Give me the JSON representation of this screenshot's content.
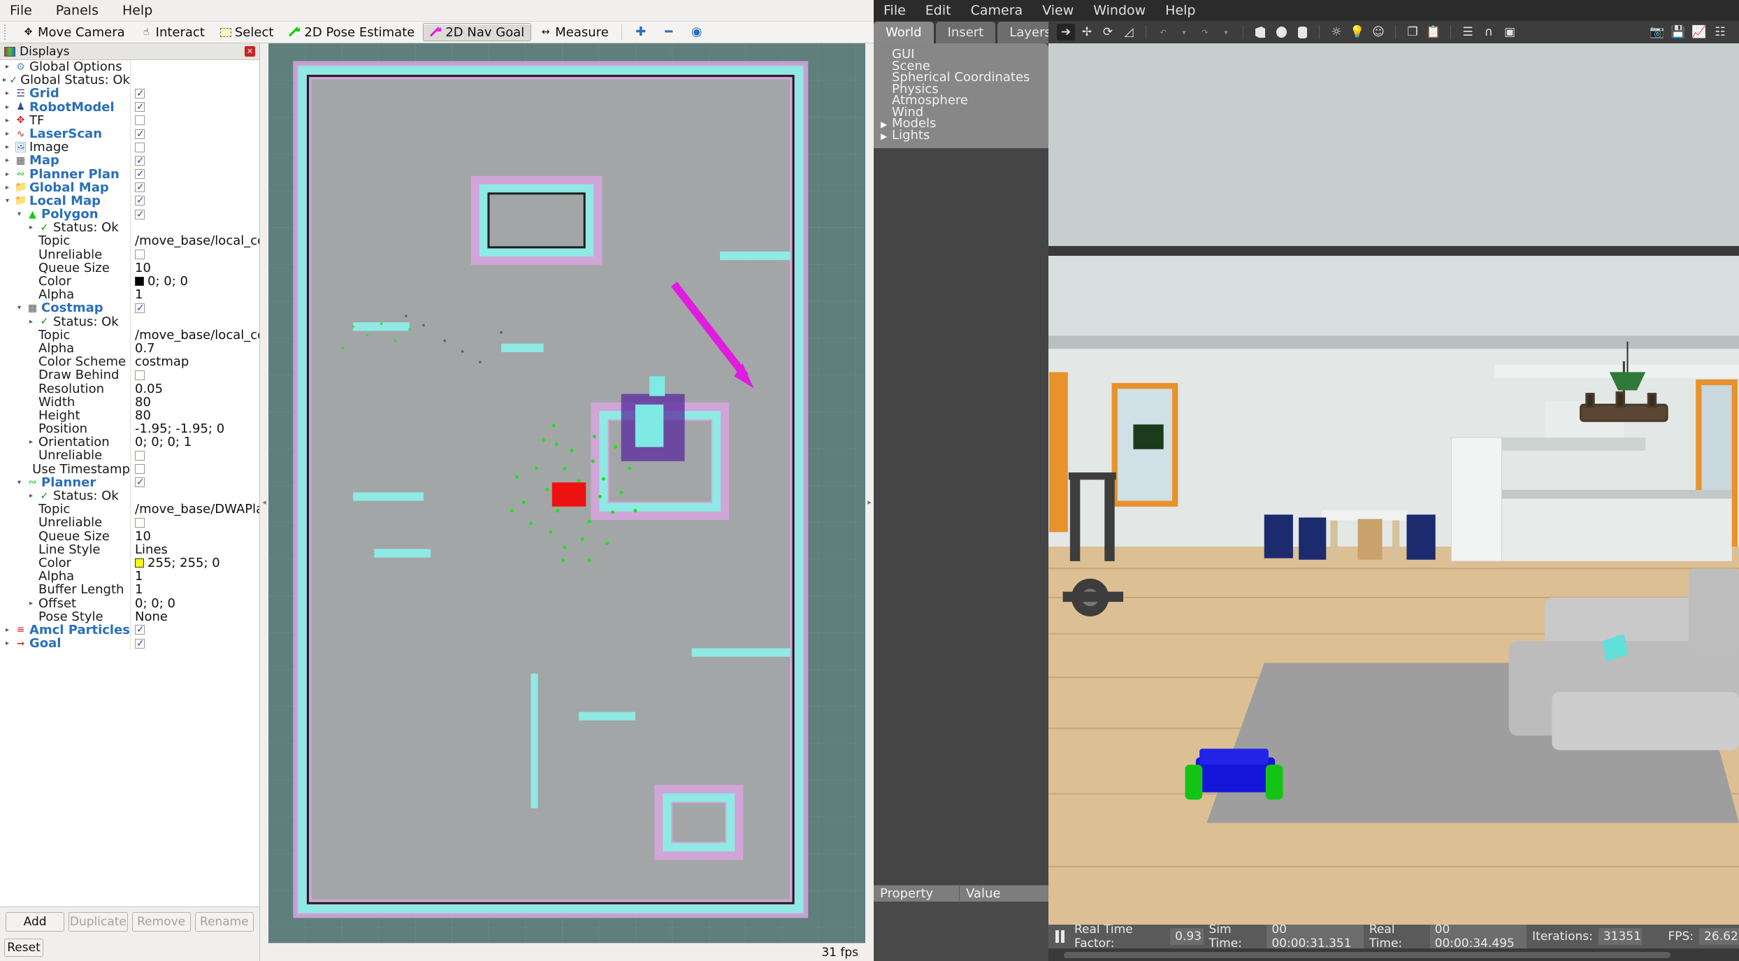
{
  "rviz": {
    "menubar": [
      "File",
      "Panels",
      "Help"
    ],
    "toolbar": [
      {
        "label": "Move Camera",
        "icon": "move-camera-icon",
        "active": false
      },
      {
        "label": "Interact",
        "icon": "hand-icon",
        "active": false
      },
      {
        "label": "Select",
        "icon": "select-rect-icon",
        "active": false
      },
      {
        "label": "2D Pose Estimate",
        "icon": "green-arrow-icon",
        "active": false
      },
      {
        "label": "2D Nav Goal",
        "icon": "magenta-arrow-icon",
        "active": true
      },
      {
        "label": "Measure",
        "icon": "measure-icon",
        "active": false
      }
    ],
    "displays_title": "Displays",
    "tree": [
      {
        "indent": 0,
        "arrow": "r",
        "icon": "gear",
        "label": "Global Options",
        "link": false,
        "value": "",
        "type": "none"
      },
      {
        "indent": 0,
        "arrow": "r",
        "icon": "check",
        "label": "Global Status: Ok",
        "link": false,
        "value": "",
        "type": "none"
      },
      {
        "indent": 0,
        "arrow": "r",
        "icon": "grid",
        "label": "Grid",
        "link": true,
        "value": "",
        "type": "check-on"
      },
      {
        "indent": 0,
        "arrow": "r",
        "icon": "robot",
        "label": "RobotModel",
        "link": true,
        "value": "",
        "type": "check-on"
      },
      {
        "indent": 0,
        "arrow": "r",
        "icon": "tf",
        "label": "TF",
        "link": false,
        "value": "",
        "type": "check-off"
      },
      {
        "indent": 0,
        "arrow": "r",
        "icon": "laser",
        "label": "LaserScan",
        "link": true,
        "value": "",
        "type": "check-on"
      },
      {
        "indent": 0,
        "arrow": "r",
        "icon": "image",
        "label": "Image",
        "link": false,
        "value": "",
        "type": "check-off"
      },
      {
        "indent": 0,
        "arrow": "r",
        "icon": "map",
        "label": "Map",
        "link": true,
        "value": "",
        "type": "check-on"
      },
      {
        "indent": 0,
        "arrow": "r",
        "icon": "path",
        "label": "Planner Plan",
        "link": true,
        "value": "",
        "type": "check-on"
      },
      {
        "indent": 0,
        "arrow": "r",
        "icon": "folder",
        "label": "Global Map",
        "link": true,
        "value": "",
        "type": "check-on"
      },
      {
        "indent": 0,
        "arrow": "d",
        "icon": "folder",
        "label": "Local Map",
        "link": true,
        "value": "",
        "type": "check-on"
      },
      {
        "indent": 1,
        "arrow": "d",
        "icon": "polygon",
        "label": "Polygon",
        "link": true,
        "value": "",
        "type": "check-on"
      },
      {
        "indent": 2,
        "arrow": "r",
        "icon": "check",
        "label": "Status: Ok",
        "link": false,
        "value": "",
        "type": "none"
      },
      {
        "indent": 2,
        "arrow": "none",
        "icon": "none",
        "label": "Topic",
        "link": false,
        "value": "/move_base/local_cost...",
        "type": "text"
      },
      {
        "indent": 2,
        "arrow": "none",
        "icon": "none",
        "label": "Unreliable",
        "link": false,
        "value": "",
        "type": "check-off"
      },
      {
        "indent": 2,
        "arrow": "none",
        "icon": "none",
        "label": "Queue Size",
        "link": false,
        "value": "10",
        "type": "text"
      },
      {
        "indent": 2,
        "arrow": "none",
        "icon": "none",
        "label": "Color",
        "link": false,
        "value": "0; 0; 0",
        "type": "color",
        "swatch": "#000000"
      },
      {
        "indent": 2,
        "arrow": "none",
        "icon": "none",
        "label": "Alpha",
        "link": false,
        "value": "1",
        "type": "text"
      },
      {
        "indent": 1,
        "arrow": "d",
        "icon": "map",
        "label": "Costmap",
        "link": true,
        "value": "",
        "type": "check-on"
      },
      {
        "indent": 2,
        "arrow": "r",
        "icon": "check",
        "label": "Status: Ok",
        "link": false,
        "value": "",
        "type": "none"
      },
      {
        "indent": 2,
        "arrow": "none",
        "icon": "none",
        "label": "Topic",
        "link": false,
        "value": "/move_base/local_cost...",
        "type": "text"
      },
      {
        "indent": 2,
        "arrow": "none",
        "icon": "none",
        "label": "Alpha",
        "link": false,
        "value": "0.7",
        "type": "text"
      },
      {
        "indent": 2,
        "arrow": "none",
        "icon": "none",
        "label": "Color Scheme",
        "link": false,
        "value": "costmap",
        "type": "text"
      },
      {
        "indent": 2,
        "arrow": "none",
        "icon": "none",
        "label": "Draw Behind",
        "link": false,
        "value": "",
        "type": "check-off"
      },
      {
        "indent": 2,
        "arrow": "none",
        "icon": "none",
        "label": "Resolution",
        "link": false,
        "value": "0.05",
        "type": "text"
      },
      {
        "indent": 2,
        "arrow": "none",
        "icon": "none",
        "label": "Width",
        "link": false,
        "value": "80",
        "type": "text"
      },
      {
        "indent": 2,
        "arrow": "none",
        "icon": "none",
        "label": "Height",
        "link": false,
        "value": "80",
        "type": "text"
      },
      {
        "indent": 2,
        "arrow": "none",
        "icon": "none",
        "label": "Position",
        "link": false,
        "value": "-1.95; -1.95; 0",
        "type": "text"
      },
      {
        "indent": 2,
        "arrow": "r",
        "icon": "none",
        "label": "Orientation",
        "link": false,
        "value": "0; 0; 0; 1",
        "type": "text"
      },
      {
        "indent": 2,
        "arrow": "none",
        "icon": "none",
        "label": "Unreliable",
        "link": false,
        "value": "",
        "type": "check-off"
      },
      {
        "indent": 2,
        "arrow": "none",
        "icon": "none",
        "label": "Use Timestamp",
        "link": false,
        "value": "",
        "type": "check-off"
      },
      {
        "indent": 1,
        "arrow": "d",
        "icon": "path",
        "label": "Planner",
        "link": true,
        "value": "",
        "type": "check-on"
      },
      {
        "indent": 2,
        "arrow": "r",
        "icon": "check",
        "label": "Status: Ok",
        "link": false,
        "value": "",
        "type": "none"
      },
      {
        "indent": 2,
        "arrow": "none",
        "icon": "none",
        "label": "Topic",
        "link": false,
        "value": "/move_base/DWAPlan...",
        "type": "text"
      },
      {
        "indent": 2,
        "arrow": "none",
        "icon": "none",
        "label": "Unreliable",
        "link": false,
        "value": "",
        "type": "check-off"
      },
      {
        "indent": 2,
        "arrow": "none",
        "icon": "none",
        "label": "Queue Size",
        "link": false,
        "value": "10",
        "type": "text"
      },
      {
        "indent": 2,
        "arrow": "none",
        "icon": "none",
        "label": "Line Style",
        "link": false,
        "value": "Lines",
        "type": "text"
      },
      {
        "indent": 2,
        "arrow": "none",
        "icon": "none",
        "label": "Color",
        "link": false,
        "value": "255; 255; 0",
        "type": "color",
        "swatch": "#ffff00"
      },
      {
        "indent": 2,
        "arrow": "none",
        "icon": "none",
        "label": "Alpha",
        "link": false,
        "value": "1",
        "type": "text"
      },
      {
        "indent": 2,
        "arrow": "none",
        "icon": "none",
        "label": "Buffer Length",
        "link": false,
        "value": "1",
        "type": "text"
      },
      {
        "indent": 2,
        "arrow": "r",
        "icon": "none",
        "label": "Offset",
        "link": false,
        "value": "0; 0; 0",
        "type": "text"
      },
      {
        "indent": 2,
        "arrow": "none",
        "icon": "none",
        "label": "Pose Style",
        "link": false,
        "value": "None",
        "type": "text"
      },
      {
        "indent": 0,
        "arrow": "r",
        "icon": "particles",
        "label": "Amcl Particles",
        "link": true,
        "value": "",
        "type": "check-on"
      },
      {
        "indent": 0,
        "arrow": "r",
        "icon": "goal",
        "label": "Goal",
        "link": true,
        "value": "",
        "type": "check-on"
      }
    ],
    "buttons": {
      "add": "Add",
      "duplicate": "Duplicate",
      "remove": "Remove",
      "rename": "Rename",
      "reset": "Reset"
    },
    "status_fps": "31 fps"
  },
  "gazebo": {
    "menubar": [
      "File",
      "Edit",
      "Camera",
      "View",
      "Window",
      "Help"
    ],
    "tabs": [
      {
        "label": "World",
        "active": true
      },
      {
        "label": "Insert",
        "active": false
      },
      {
        "label": "Layers",
        "active": false
      }
    ],
    "world_tree": [
      {
        "label": "GUI",
        "expandable": false
      },
      {
        "label": "Scene",
        "expandable": false
      },
      {
        "label": "Spherical Coordinates",
        "expandable": false
      },
      {
        "label": "Physics",
        "expandable": false
      },
      {
        "label": "Atmosphere",
        "expandable": false
      },
      {
        "label": "Wind",
        "expandable": false
      },
      {
        "label": "Models",
        "expandable": true
      },
      {
        "label": "Lights",
        "expandable": true
      }
    ],
    "property_header": {
      "property": "Property",
      "value": "Value"
    },
    "toolbar_icons": [
      "select-arrow-icon",
      "translate-icon",
      "rotate-icon",
      "scale-icon",
      "undo-icon",
      "undo-dropdown-icon",
      "redo-icon",
      "redo-dropdown-icon",
      "box-icon",
      "sphere-icon",
      "cylinder-icon",
      "point-light-icon",
      "spot-light-icon",
      "directional-light-icon",
      "copy-icon",
      "paste-icon",
      "align-icon",
      "snap-icon",
      "view-angle-icon"
    ],
    "toolbar_right_icons": [
      "screenshot-icon",
      "save-icon",
      "plot-icon",
      "topic-icon"
    ],
    "status": {
      "rtf_label": "Real Time Factor:",
      "rtf_value": "0.93",
      "sim_label": "Sim Time:",
      "sim_value": "00 00:00:31.351",
      "real_label": "Real Time:",
      "real_value": "00 00:00:34.495",
      "iter_label": "Iterations:",
      "iter_value": "31351",
      "fps_label": "FPS:",
      "fps_value": "26.62"
    }
  }
}
